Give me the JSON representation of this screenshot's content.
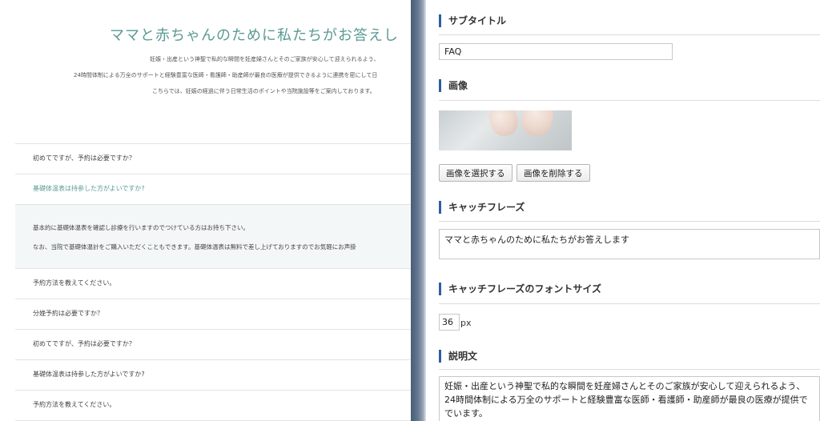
{
  "preview": {
    "title": "ママと赤ちゃんのために私たちがお答えし",
    "intro": [
      "妊娠・出産という神聖で私的な瞬間を妊産婦さんとそのご家族が安心して迎えられるよう、",
      "24時間体制による万全のサポートと経験豊富な医師・看護師・助産師が最良の医療が提供できるように連携を密にして日",
      "こちらでは、妊娠の経過に伴う日常生活のポイントや当院施設等をご案内しております。"
    ],
    "faq": [
      {
        "q": "初めてですが、予約は必要ですか？",
        "open": false
      },
      {
        "q": "基礎体温表は持参した方がよいですか?",
        "open": true,
        "a": [
          "基本的に基礎体温表を確認し診療を行いますのでつけている方はお持ち下さい。",
          "なお、当院で基礎体温計をご購入いただくこともできます。基礎体温表は無料で差し上げておりますのでお気軽にお声掛"
        ]
      },
      {
        "q": "予約方法を教えてください。",
        "open": false
      },
      {
        "q": "分娩予約は必要ですか？",
        "open": false
      },
      {
        "q": "初めてですが、予約は必要ですか？",
        "open": false
      },
      {
        "q": "基礎体温表は持参した方がよいですか?",
        "open": false
      },
      {
        "q": "予約方法を教えてください。",
        "open": false
      }
    ]
  },
  "settings": {
    "subtitle": {
      "label": "サブタイトル",
      "value": "FAQ"
    },
    "image": {
      "label": "画像",
      "select_button": "画像を選択する",
      "delete_button": "画像を削除する"
    },
    "catchphrase": {
      "label": "キャッチフレーズ",
      "value": "ママと赤ちゃんのために私たちがお答えします"
    },
    "catchphrase_font_size": {
      "label": "キャッチフレーズのフォントサイズ",
      "value": "36",
      "unit": "px"
    },
    "description": {
      "label": "説明文",
      "lines": [
        "妊娠・出産という神聖で私的な瞬間を妊産婦さんとそのご家族が安心して迎えられるよう、",
        "24時間体制による万全のサポートと経験豊富な医師・看護師・助産師が最良の医療が提供で",
        "でいます。"
      ]
    }
  },
  "colors": {
    "accent": "#5b9a94",
    "section_bar": "#2e5f9e"
  }
}
